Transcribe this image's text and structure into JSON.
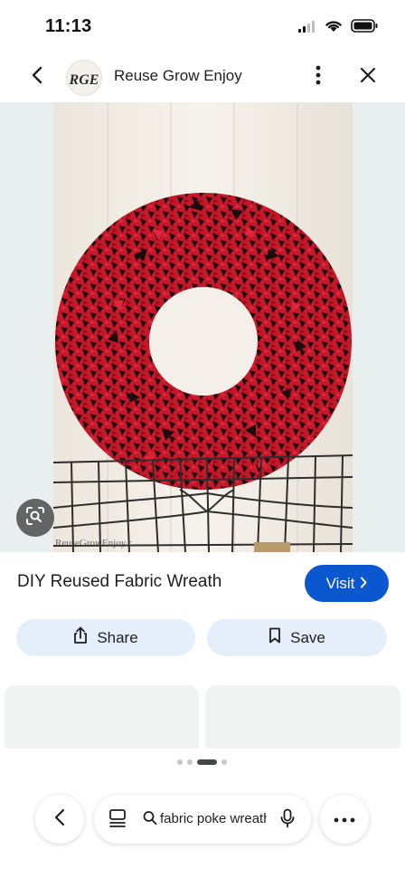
{
  "status_bar": {
    "time": "11:13"
  },
  "header": {
    "site_name": "Reuse Grow Enjoy",
    "logo_text": "RGE"
  },
  "image": {
    "watermark": "ReuseGrowEnjoy.c"
  },
  "pin": {
    "title": "DIY Reused Fabric Wreath",
    "visit_label": "Visit"
  },
  "actions": {
    "share_label": "Share",
    "save_label": "Save"
  },
  "carousel": {
    "pages": 4,
    "active_index": 2
  },
  "bottom_nav": {
    "search_query": "fabric poke wreath"
  },
  "colors": {
    "accent": "#0b57d0",
    "action_bg": "#e5eefb",
    "wreath_red": "#c3172a",
    "wreath_dark": "#1c0d0e"
  },
  "icons": [
    "signal-icon",
    "wifi-icon",
    "battery-icon",
    "back-icon",
    "more-vertical-icon",
    "close-icon",
    "lens-icon",
    "share-icon",
    "bookmark-icon",
    "feed-icon",
    "search-icon",
    "mic-icon",
    "more-horizontal-icon"
  ]
}
